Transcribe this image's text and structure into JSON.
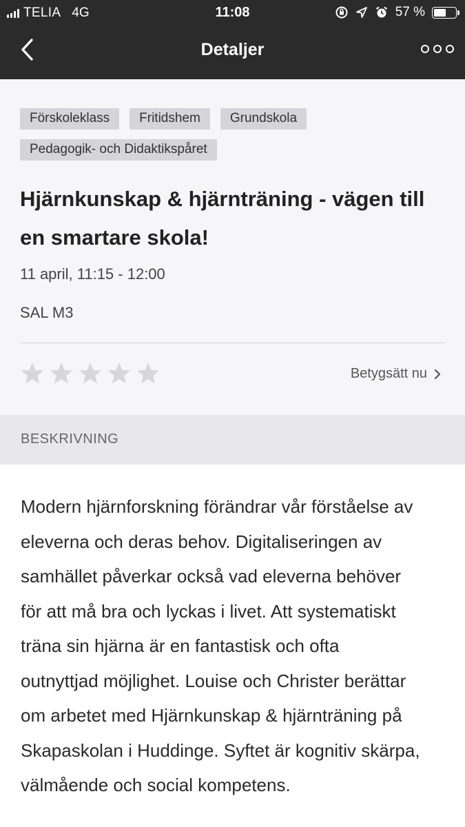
{
  "status_bar": {
    "carrier": "TELIA",
    "network": "4G",
    "time": "11:08",
    "battery": "57 %",
    "battery_level": 0.57
  },
  "navbar": {
    "title": "Detaljer",
    "back_icon": "chevron-left-icon",
    "more_icon": "more-dots-icon"
  },
  "event": {
    "tags": [
      "Förskoleklass",
      "Fritidshem",
      "Grundskola",
      "Pedagogik- och Didaktikspåret"
    ],
    "title": "Hjärnkunskap & hjärnträning - vägen till en smartare skola!",
    "time": "11 april,  11:15 - 12:00",
    "room": "SAL M3"
  },
  "rating": {
    "stars_total": 5,
    "stars_filled": 0,
    "rate_label": "Betygsätt nu",
    "star_color": "#d6d6db"
  },
  "description": {
    "heading": "BESKRIVNING",
    "text": "Modern hjärnforskning förändrar vår förståelse av eleverna och deras behov. Digitaliseringen av samhället påverkar också vad eleverna behöver för att må bra och lyckas i livet. Att systematiskt träna sin hjärna är en fantastisk och ofta outnyttjad möjlighet. Louise och Christer berättar om arbetet med Hjärnkunskap & hjärnträning på Skapaskolan i Huddinge. Syftet är kognitiv skärpa, välmående och social kompetens."
  }
}
